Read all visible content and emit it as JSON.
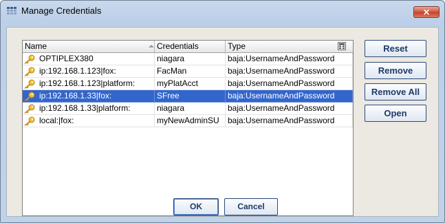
{
  "window": {
    "title": "Manage Credentials",
    "close_label": "✕"
  },
  "table": {
    "columns": [
      "Name",
      "Credentials",
      "Type"
    ],
    "rows": [
      {
        "name": "OPTIPLEX380",
        "credentials": "niagara",
        "type": "baja:UsernameAndPassword",
        "selected": false
      },
      {
        "name": "ip:192.168.1.123|fox:",
        "credentials": "FacMan",
        "type": "baja:UsernameAndPassword",
        "selected": false
      },
      {
        "name": "ip:192.168.1.123|platform:",
        "credentials": "myPlatAcct",
        "type": "baja:UsernameAndPassword",
        "selected": false
      },
      {
        "name": "ip:192.168.1.33|fox:",
        "credentials": "SFree",
        "type": "baja:UsernameAndPassword",
        "selected": true
      },
      {
        "name": "ip:192.168.1.33|platform:",
        "credentials": "niagara",
        "type": "baja:UsernameAndPassword",
        "selected": false
      },
      {
        "name": "local:|fox:",
        "credentials": "myNewAdminSU",
        "type": "baja:UsernameAndPassword",
        "selected": false
      }
    ]
  },
  "side_buttons": {
    "reset": "Reset",
    "remove": "Remove",
    "remove_all": "Remove All",
    "open": "Open"
  },
  "dialog_buttons": {
    "ok": "OK",
    "cancel": "Cancel"
  },
  "colors": {
    "selection": "#3366cc",
    "close": "#c7402a",
    "button_text": "#1e3a66"
  },
  "icons": {
    "title": "credentials-grid-icon",
    "row": "key-icon",
    "column_chooser": "column-chooser-icon"
  }
}
